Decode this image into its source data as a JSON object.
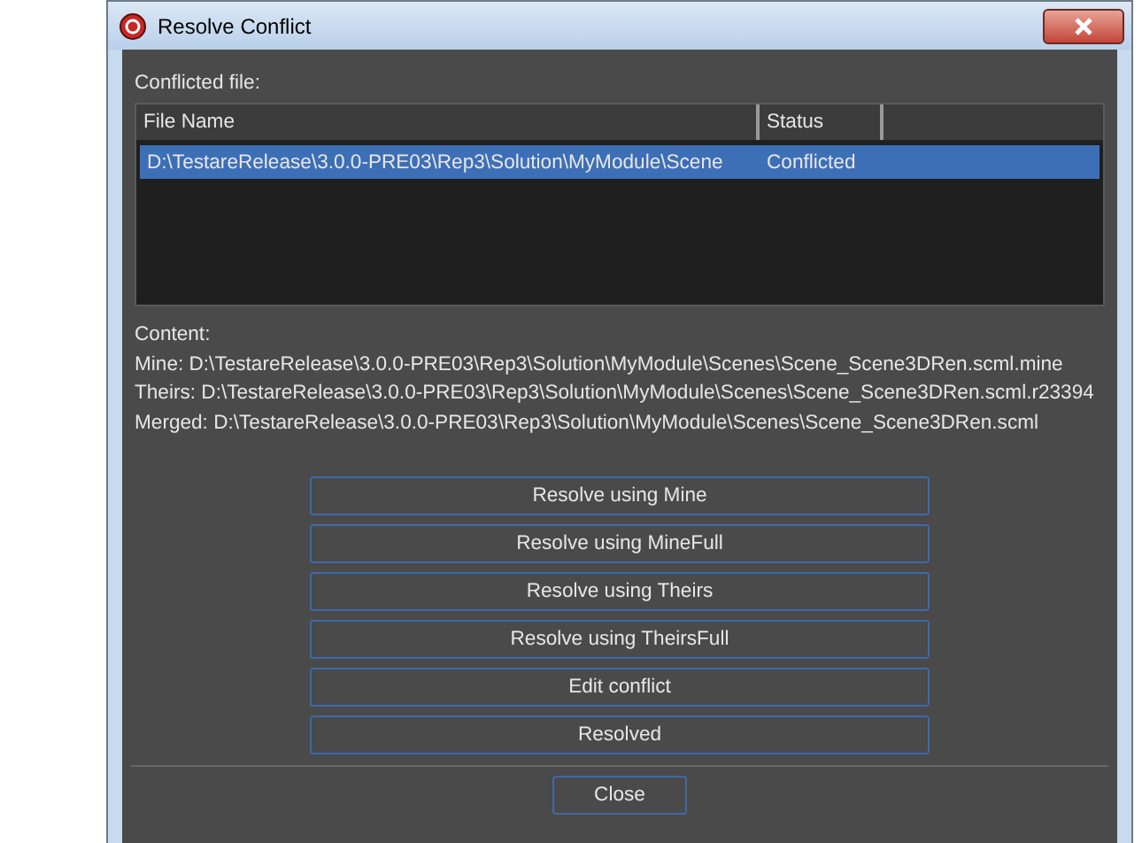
{
  "window": {
    "title": "Resolve Conflict"
  },
  "conflicted_label": "Conflicted file:",
  "table": {
    "columns": [
      "File Name",
      "Status"
    ],
    "rows": [
      {
        "file_name": "D:\\TestareRelease\\3.0.0-PRE03\\Rep3\\Solution\\MyModule\\Scene",
        "status": "Conflicted",
        "selected": true
      }
    ]
  },
  "content_label": "Content:",
  "content_lines": [
    "Mine: D:\\TestareRelease\\3.0.0-PRE03\\Rep3\\Solution\\MyModule\\Scenes\\Scene_Scene3DRen.scml.mine",
    "Theirs: D:\\TestareRelease\\3.0.0-PRE03\\Rep3\\Solution\\MyModule\\Scenes\\Scene_Scene3DRen.scml.r23394",
    "Merged: D:\\TestareRelease\\3.0.0-PRE03\\Rep3\\Solution\\MyModule\\Scenes\\Scene_Scene3DRen.scml"
  ],
  "buttons": [
    "Resolve using Mine",
    "Resolve using MineFull",
    "Resolve using Theirs",
    "Resolve using TheirsFull",
    "Edit conflict",
    "Resolved"
  ],
  "close_button": "Close"
}
